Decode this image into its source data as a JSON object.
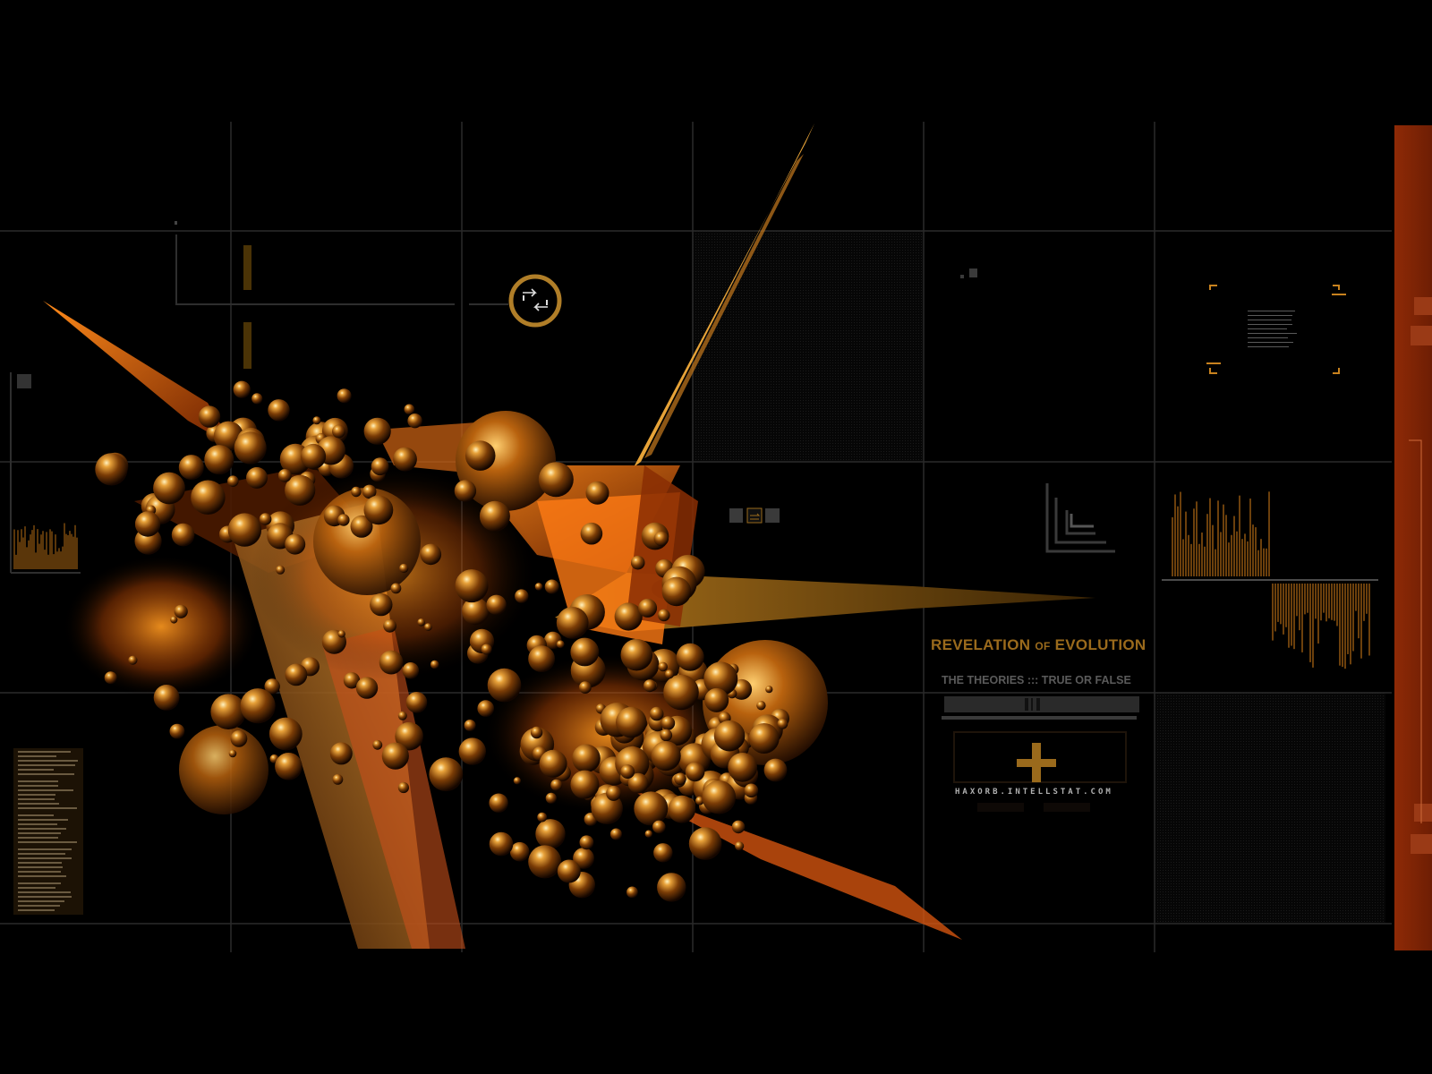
{
  "title": {
    "word1": "REVELATION",
    "word2": "OF",
    "word3": "EVOLUTION"
  },
  "subtitle": "THE THEORIES ::: TRUE OR FALSE",
  "url": "HAXORB.INTELLSTAT.COM",
  "colors": {
    "background": "#000000",
    "accent_orange": "#c8761a",
    "title_gold": "#9a6a1c",
    "grid": "#2a2a2a",
    "sidebar_red": "#8e2a06"
  },
  "icons": {
    "swap": "swap-arrows-icon",
    "plus": "plus-icon"
  }
}
